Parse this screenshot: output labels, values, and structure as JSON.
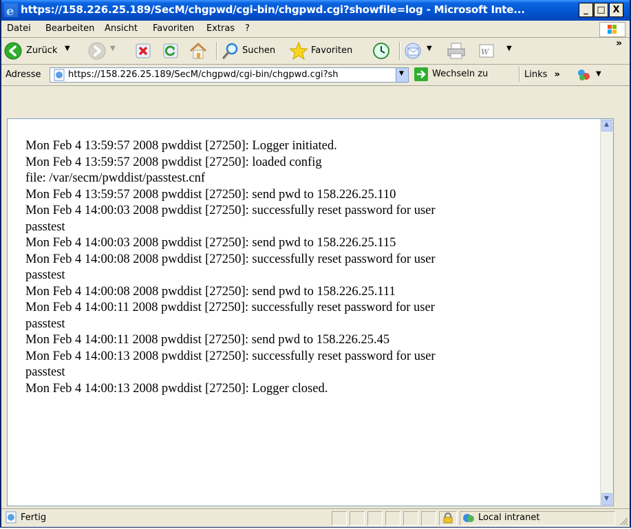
{
  "window": {
    "title": "https://158.226.25.189/SecM/chgpwd/cgi-bin/chgpwd.cgi?showfile=log - Microsoft Inte...",
    "minimize": "_",
    "maximize": "□",
    "close": "X"
  },
  "menubar": {
    "items": [
      {
        "label": "Datei",
        "accel": "D"
      },
      {
        "label": "Bearbeiten",
        "accel": "B"
      },
      {
        "label": "Ansicht",
        "accel": "A"
      },
      {
        "label": "Favoriten",
        "accel": "F"
      },
      {
        "label": "Extras",
        "accel": "x"
      },
      {
        "label": "?",
        "accel": "?"
      }
    ]
  },
  "toolbar": {
    "back_label": "Zurück",
    "search_label": "Suchen",
    "favorites_label": "Favoriten",
    "more": "»"
  },
  "addressbar": {
    "label": "Adresse",
    "url": "https://158.226.25.189/SecM/chgpwd/cgi-bin/chgpwd.cgi?sh",
    "go_label": "Wechseln zu",
    "links_label": "Links",
    "links_more": "»"
  },
  "log": {
    "lines": [
      "Mon Feb 4 13:59:57 2008 pwddist [27250]: Logger initiated.",
      "Mon Feb 4 13:59:57 2008 pwddist [27250]: loaded config",
      "file: /var/secm/pwddist/passtest.cnf",
      "Mon Feb 4 13:59:57 2008 pwddist [27250]: send pwd to 158.226.25.110",
      "Mon Feb 4 14:00:03 2008 pwddist [27250]: successfully reset password for user",
      "passtest",
      "Mon Feb 4 14:00:03 2008 pwddist [27250]: send pwd to 158.226.25.115",
      "Mon Feb 4 14:00:08 2008 pwddist [27250]: successfully reset password for user",
      "passtest",
      "Mon Feb 4 14:00:08 2008 pwddist [27250]: send pwd to 158.226.25.111",
      "Mon Feb 4 14:00:11 2008 pwddist [27250]: successfully reset password for user",
      "passtest",
      "Mon Feb 4 14:00:11 2008 pwddist [27250]: send pwd to 158.226.25.45",
      "Mon Feb 4 14:00:13 2008 pwddist [27250]: successfully reset password for user",
      "passtest",
      "Mon Feb 4 14:00:13 2008 pwddist [27250]: Logger closed."
    ]
  },
  "statusbar": {
    "text": "Fertig",
    "zone": "Local intranet"
  },
  "colors": {
    "titlebar": "#0453d0",
    "chrome": "#ece9d8"
  }
}
